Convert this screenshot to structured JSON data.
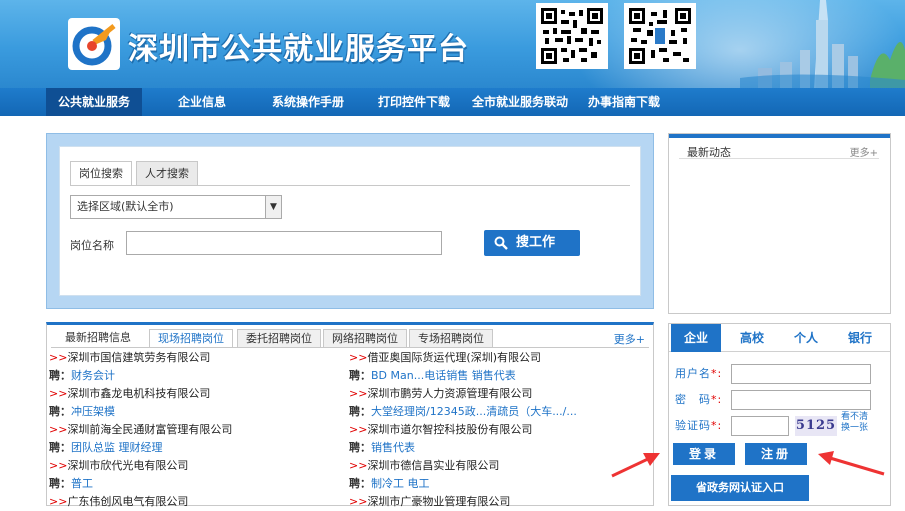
{
  "header": {
    "site_title": "深圳市公共就业服务平台"
  },
  "nav": {
    "items": [
      {
        "label": "公共就业服务"
      },
      {
        "label": "企业信息"
      },
      {
        "label": "系统操作手册"
      },
      {
        "label": "打印控件下载"
      },
      {
        "label": "全市就业服务联动"
      },
      {
        "label": "办事指南下载"
      }
    ]
  },
  "search": {
    "tabs": [
      {
        "label": "岗位搜索"
      },
      {
        "label": "人才搜索"
      }
    ],
    "region_select_value": "选择区域(默认全市)",
    "job_name_label": "岗位名称",
    "job_name_value": "",
    "search_button": "搜工作"
  },
  "news": {
    "title": "最新动态",
    "more": "更多+"
  },
  "jobs": {
    "tabs": [
      {
        "label": "最新招聘信息"
      },
      {
        "label": "现场招聘岗位"
      },
      {
        "label": "委托招聘岗位"
      },
      {
        "label": "网络招聘岗位"
      },
      {
        "label": "专场招聘岗位"
      }
    ],
    "more": "更多+",
    "marker": ">>",
    "pin_label": "聘：",
    "left": [
      {
        "company": "深圳市国信建筑劳务有限公司",
        "positions": "财务会计"
      },
      {
        "company": "深圳市鑫龙电机科技有限公司",
        "positions": "冲压架模"
      },
      {
        "company": "深圳前海全民通财富管理有限公司",
        "positions": "团队总监 理财经理"
      },
      {
        "company": "深圳市欣代光电有限公司",
        "positions": "普工"
      },
      {
        "company": "广东伟创风电气有限公司",
        "positions": ""
      }
    ],
    "right": [
      {
        "company": "借亚奥国际货运代理(深圳)有限公司",
        "positions": "BD Man...电话销售 销售代表"
      },
      {
        "company": "深圳市鹏劳人力资源管理有限公司",
        "positions": "大堂经理岗/12345政...清疏员（大车.../..."
      },
      {
        "company": "深圳市道尔智控科技股份有限公司",
        "positions": "销售代表"
      },
      {
        "company": "深圳市德信昌实业有限公司",
        "positions": "制冷工 电工"
      },
      {
        "company": "深圳市广豪物业管理有限公司",
        "positions": ""
      }
    ]
  },
  "login": {
    "tabs": [
      {
        "label": "企业"
      },
      {
        "label": "高校"
      },
      {
        "label": "个人"
      },
      {
        "label": "银行"
      }
    ],
    "username_label": "用户名",
    "password_label": "密　码",
    "captcha_label": "验证码",
    "required_mark": "*:",
    "captcha_text": "5125",
    "captcha_hint": "看不清换一张",
    "login_button": "登录",
    "register_button": "注册",
    "gov_button": "省政务网认证入口"
  },
  "colors": {
    "brand_blue": "#1f73c7",
    "red": "#e00000"
  }
}
